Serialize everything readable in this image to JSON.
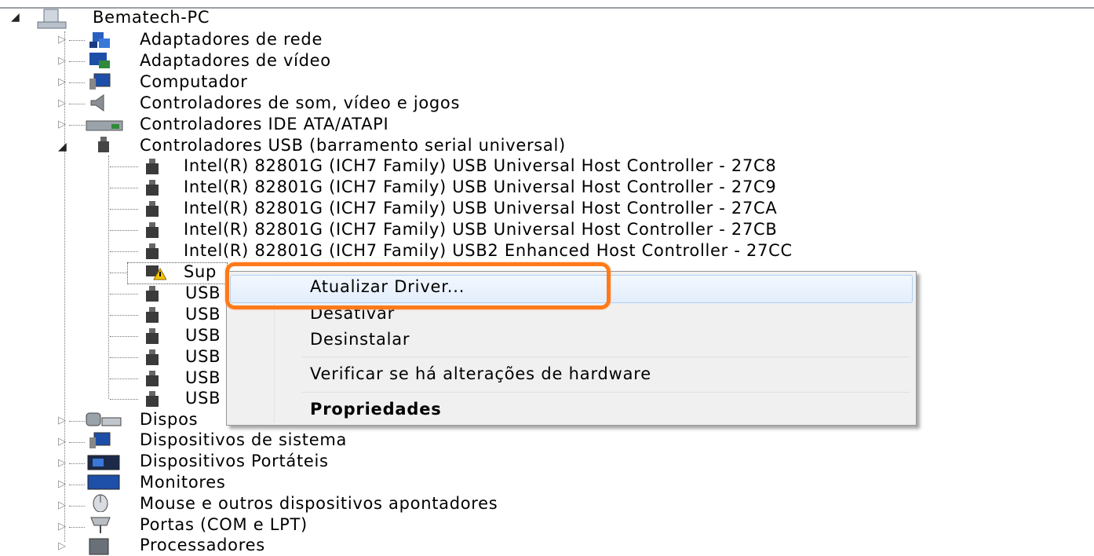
{
  "tree": {
    "root": {
      "label": "Bematech-PC",
      "icon": "computer-icon"
    },
    "categories_top": [
      {
        "label": "Adaptadores de rede",
        "icon": "network-adapter-icon"
      },
      {
        "label": "Adaptadores de vídeo",
        "icon": "display-adapter-icon"
      },
      {
        "label": "Computador",
        "icon": "computer-icon"
      },
      {
        "label": "Controladores de som, vídeo e jogos",
        "icon": "speaker-icon"
      },
      {
        "label": "Controladores IDE ATA/ATAPI",
        "icon": "ide-controller-icon"
      },
      {
        "label": "Controladores USB (barramento serial universal)",
        "icon": "usb-icon"
      }
    ],
    "usb_children": [
      {
        "label": "Intel(R) 82801G (ICH7 Family) USB Universal Host Controller - 27C8"
      },
      {
        "label": "Intel(R) 82801G (ICH7 Family) USB Universal Host Controller - 27C9"
      },
      {
        "label": "Intel(R) 82801G (ICH7 Family) USB Universal Host Controller - 27CA"
      },
      {
        "label": "Intel(R) 82801G (ICH7 Family) USB Universal Host Controller - 27CB"
      },
      {
        "label": "Intel(R) 82801G (ICH7 Family) USB2 Enhanced Host Controller - 27CC"
      },
      {
        "label": "Sup",
        "warning": true
      },
      {
        "label": "USB"
      },
      {
        "label": "USB"
      },
      {
        "label": "USB"
      },
      {
        "label": "USB"
      },
      {
        "label": "USB"
      },
      {
        "label": "USB"
      }
    ],
    "categories_bottom": [
      {
        "label": "Dispos",
        "icon": "hid-icon"
      },
      {
        "label": "Dispositivos de sistema",
        "icon": "system-device-icon"
      },
      {
        "label": "Dispositivos Portáteis",
        "icon": "portable-device-icon"
      },
      {
        "label": "Monitores",
        "icon": "monitor-icon"
      },
      {
        "label": "Mouse e outros dispositivos apontadores",
        "icon": "mouse-icon"
      },
      {
        "label": "Portas (COM e LPT)",
        "icon": "port-icon"
      },
      {
        "label": "Processadores",
        "icon": "processor-icon"
      }
    ]
  },
  "context_menu": {
    "items": [
      {
        "label": "Atualizar Driver...",
        "highlighted": true
      },
      {
        "label": "Desativar"
      },
      {
        "label": "Desinstalar"
      },
      {
        "label": "Verificar se há alterações de hardware"
      },
      {
        "label": "Propriedades",
        "bold": true
      }
    ]
  },
  "colors": {
    "highlight_ring": "#ff7a1a",
    "menu_bg": "#f0f0f0"
  }
}
